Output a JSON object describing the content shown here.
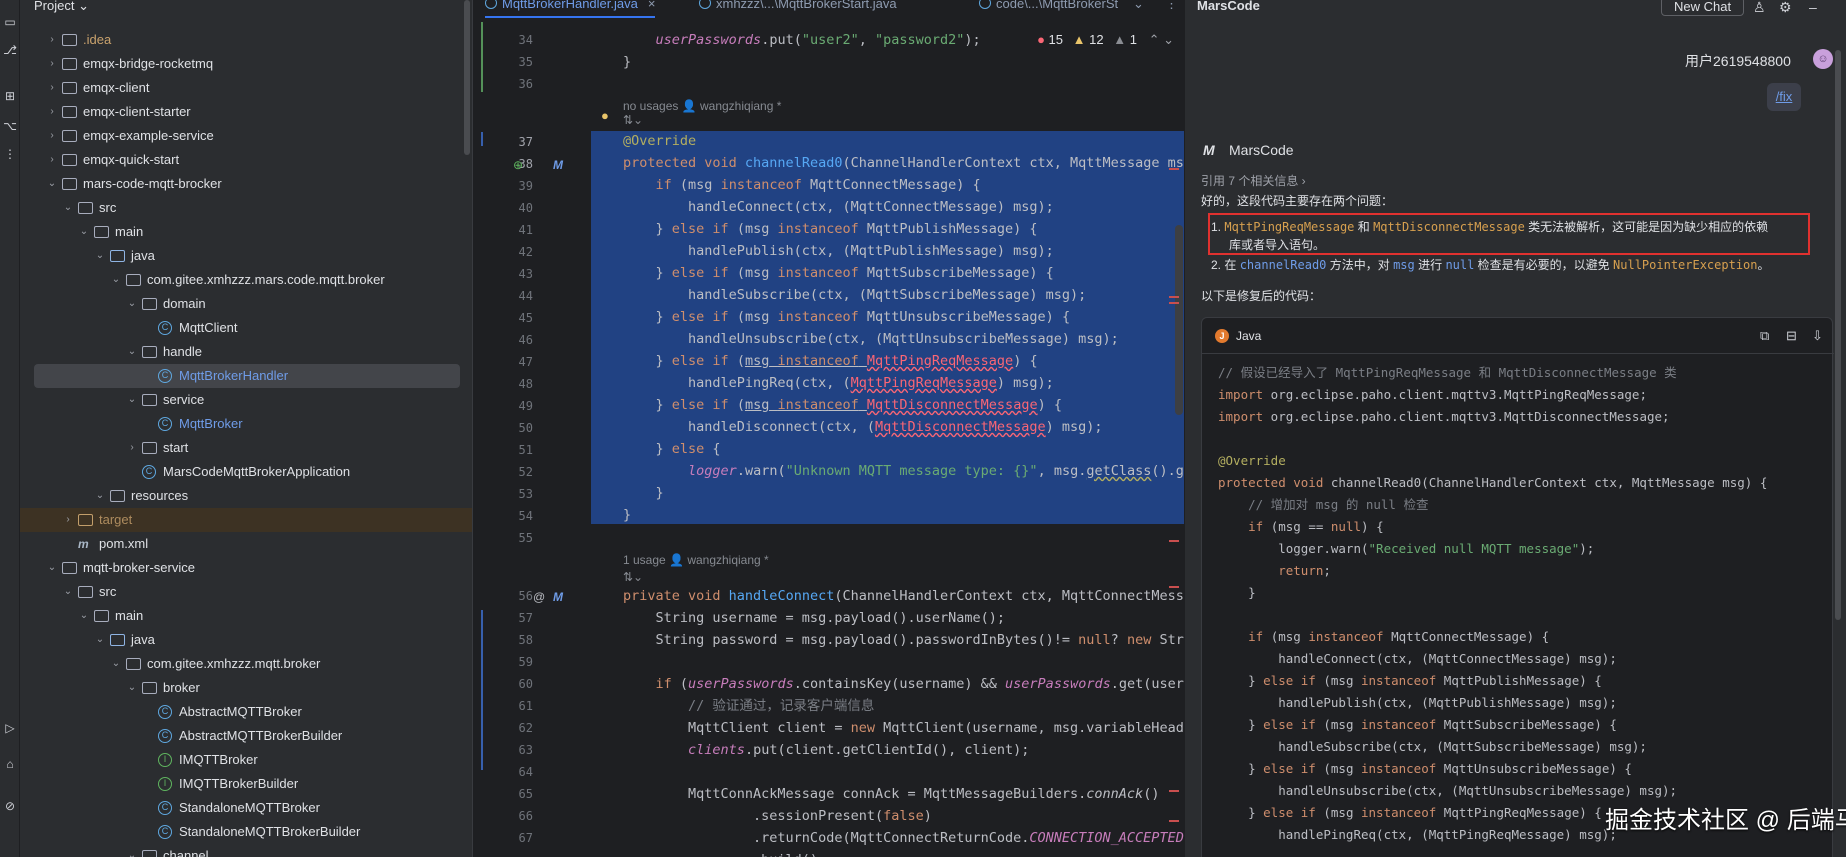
{
  "toolstrip": {
    "icons": [
      "folder-icon",
      "commit-icon",
      "structure-icon",
      "more-icon",
      "run-icon",
      "terminal-icon",
      "problems-icon"
    ]
  },
  "project": {
    "title": "Project ⌄",
    "tree": [
      {
        "label": ".idea",
        "color": "orange",
        "chev": "›",
        "icon": "folder"
      },
      {
        "label": "emqx-bridge-rocketmq",
        "chev": "›",
        "icon": "module"
      },
      {
        "label": "emqx-client",
        "chev": "›",
        "icon": "module"
      },
      {
        "label": "emqx-client-starter",
        "chev": "›",
        "icon": "module"
      },
      {
        "label": "emqx-example-service",
        "chev": "›",
        "icon": "module"
      },
      {
        "label": "emqx-quick-start",
        "chev": "›",
        "icon": "module"
      },
      {
        "label": "mars-code-mqtt-brocker",
        "chev": "⌄",
        "icon": "module"
      },
      {
        "label": "src",
        "chev": "⌄",
        "icon": "folder"
      },
      {
        "label": "main",
        "chev": "⌄",
        "icon": "folder"
      },
      {
        "label": "java",
        "chev": "⌄",
        "icon": "src"
      },
      {
        "label": "com.gitee.xmhzzz.mars.code.mqtt.broker",
        "chev": "⌄",
        "icon": "package"
      },
      {
        "label": "domain",
        "chev": "⌄",
        "icon": "package"
      },
      {
        "label": "MqttClient",
        "icon": "class"
      },
      {
        "label": "handle",
        "chev": "⌄",
        "icon": "package"
      },
      {
        "label": "MqttBrokerHandler",
        "icon": "class",
        "color": "blue",
        "selected": true
      },
      {
        "label": "service",
        "chev": "⌄",
        "icon": "package"
      },
      {
        "label": "MqttBroker",
        "icon": "class",
        "color": "blue"
      },
      {
        "label": "start",
        "chev": "›",
        "icon": "package"
      },
      {
        "label": "MarsCodeMqttBrokerApplication",
        "icon": "class"
      },
      {
        "label": "resources",
        "chev": "⌄",
        "icon": "folder"
      },
      {
        "label": "target",
        "chev": "›",
        "icon": "target",
        "color": "dim"
      },
      {
        "label": "pom.xml",
        "icon": "maven"
      },
      {
        "label": "mqtt-broker-service",
        "chev": "⌄",
        "icon": "module"
      },
      {
        "label": "src",
        "chev": "⌄",
        "icon": "folder"
      },
      {
        "label": "main",
        "chev": "⌄",
        "icon": "folder"
      },
      {
        "label": "java",
        "chev": "⌄",
        "icon": "src"
      },
      {
        "label": "com.gitee.xmhzzz.mqtt.broker",
        "chev": "⌄",
        "icon": "package"
      },
      {
        "label": "broker",
        "chev": "⌄",
        "icon": "package"
      },
      {
        "label": "AbstractMQTTBroker",
        "icon": "class"
      },
      {
        "label": "AbstractMQTTBrokerBuilder",
        "icon": "class"
      },
      {
        "label": "IMQTTBroker",
        "icon": "interface"
      },
      {
        "label": "IMQTTBrokerBuilder",
        "icon": "interface"
      },
      {
        "label": "StandaloneMQTTBroker",
        "icon": "class"
      },
      {
        "label": "StandaloneMQTTBrokerBuilder",
        "icon": "class"
      },
      {
        "label": "channel",
        "chev": "⌄",
        "icon": "package"
      }
    ]
  },
  "editor": {
    "tabs": [
      {
        "label": "MqttBrokerHandler.java",
        "active": true
      },
      {
        "label": "xmhzzz\\...\\MqttBrokerStart.java"
      },
      {
        "label": "code\\...\\MqttBrokerSt"
      }
    ],
    "tab_close": "×",
    "tab_more": "⌄",
    "tab_menu": "⋮",
    "inspections": {
      "errors": "15",
      "warnings": "12",
      "infos": "1",
      "nav": "⌃ ⌄"
    },
    "hints": [
      {
        "line": 36,
        "text": "no usages   👤 wangzhiqiang *"
      },
      {
        "line": 55,
        "text": "1 usage   👤 wangzhiqiang *"
      }
    ],
    "hint_marks": "⇅⌄",
    "line_numbers": [
      "34",
      "35",
      "36",
      "37",
      "38",
      "39",
      "40",
      "41",
      "42",
      "43",
      "44",
      "45",
      "46",
      "47",
      "48",
      "49",
      "50",
      "51",
      "52",
      "53",
      "54",
      "55",
      "56",
      "57",
      "58",
      "59",
      "60",
      "61",
      "62",
      "63",
      "64",
      "65",
      "66",
      "67"
    ]
  },
  "chat": {
    "title": "MarsCode",
    "new_chat": "New Chat",
    "header_icons": [
      "user-icon",
      "gear-icon",
      "minimize-icon"
    ],
    "user_name": "用户2619548800",
    "user_command": "/fix",
    "bot_name": "MarsCode",
    "refs": "引用 7 个相关信息 ›",
    "intro": "好的，这段代码主要存在两个问题：",
    "issue1": {
      "num": "1.",
      "c1": "MqttPingReqMessage",
      "t1": " 和 ",
      "c2": "MqttDisconnectMessage",
      "t2": " 类无法被解析，这可能是因为缺少相应的依赖",
      "t3": "库或者导入语句。"
    },
    "issue2": {
      "num": "2.",
      "t1": "在 ",
      "c1": "channelRead0",
      "t2": " 方法中，对 ",
      "c2": "msg",
      "t3": " 进行 ",
      "c3": "null",
      "t4": " 检查是有必要的，以避免 ",
      "c4": "NullPointerException",
      "t5": "。"
    },
    "fixed_label": "以下是修复后的代码：",
    "code_lang": "Java",
    "code_lang_initial": "J",
    "code_actions": [
      "copy-icon",
      "insert-icon",
      "apply-icon"
    ]
  },
  "watermark": "掘金技术社区 @ 后端马农"
}
